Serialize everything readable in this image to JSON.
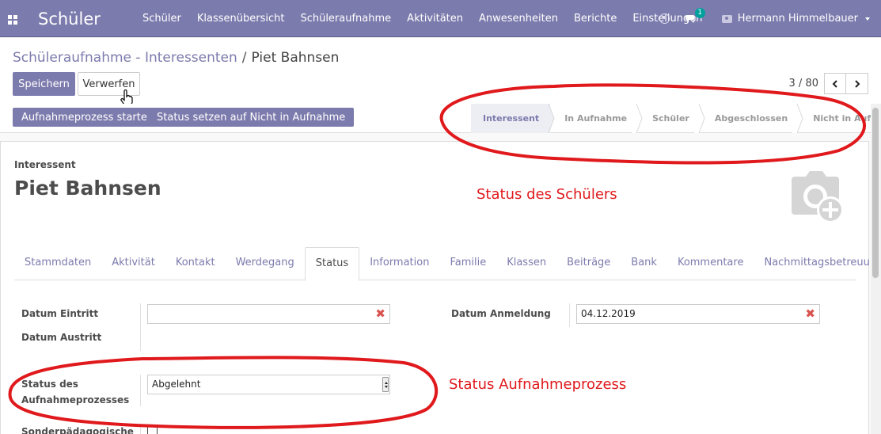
{
  "navbar": {
    "brand": "Schüler",
    "menu": [
      "Schüler",
      "Klassenübersicht",
      "Schüleraufnahme",
      "Aktivitäten",
      "Anwesenheiten",
      "Berichte",
      "Einstellungen"
    ],
    "chat_count": "1",
    "user_name": "Hermann Himmelbauer"
  },
  "breadcrumb": {
    "parent": "Schüleraufnahme - Interessenten",
    "separator": "/",
    "current": "Piet Bahnsen"
  },
  "buttons": {
    "save": "Speichern",
    "discard": "Verwerfen",
    "start_process": "Aufnahmeprozess starten",
    "set_status": "Status setzen auf Nicht in Aufnahme"
  },
  "pager": {
    "text": "3 / 80"
  },
  "stages": [
    {
      "label": "Interessent",
      "active": true
    },
    {
      "label": "In Aufnahme",
      "active": false
    },
    {
      "label": "Schüler",
      "active": false
    },
    {
      "label": "Abgeschlossen",
      "active": false
    },
    {
      "label": "Nicht in Aufnahme",
      "active": false
    }
  ],
  "record": {
    "type": "Interessent",
    "name": "Piet Bahnsen"
  },
  "tabs": [
    "Stammdaten",
    "Aktivität",
    "Kontakt",
    "Werdegang",
    "Status",
    "Information",
    "Familie",
    "Klassen",
    "Beiträge",
    "Bank",
    "Kommentare",
    "Nachmittagsbetreuung"
  ],
  "active_tab": "Status",
  "fields": {
    "datum_eintritt_label": "Datum Eintritt",
    "datum_eintritt_value": "",
    "datum_austritt_label": "Datum Austritt",
    "datum_anmeldung_label": "Datum Anmeldung",
    "datum_anmeldung_value": "04.12.2019",
    "status_label_line1": "Status des",
    "status_label_line2": "Aufnahmeprozesses",
    "status_value": "Abgelehnt",
    "sonder_label": "Sonderpädagogische"
  },
  "annotations": {
    "status_schueler": "Status des Schülers",
    "status_aufnahme": "Status Aufnahmeprozess"
  },
  "colors": {
    "brand": "#7c7bad",
    "annotation": "#e0191c",
    "clear_icon": "#d9534f"
  }
}
